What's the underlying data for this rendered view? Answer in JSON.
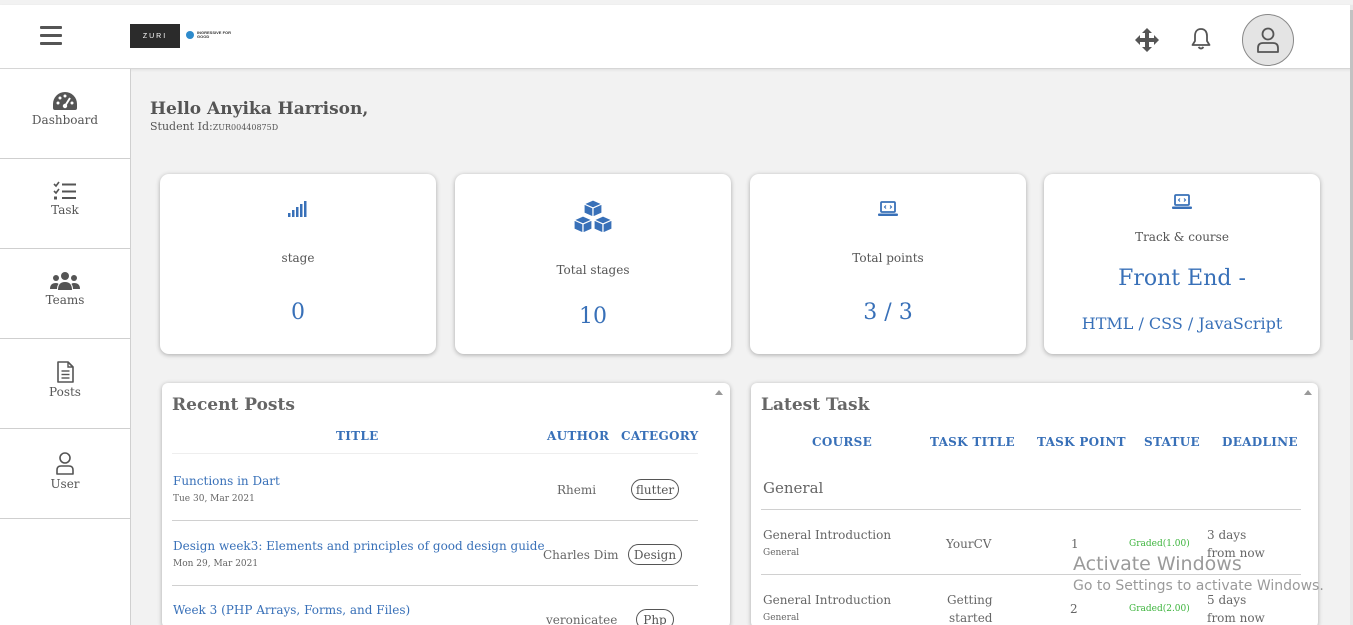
{
  "header": {
    "logo_text": "ZURI",
    "partner_logo_text": "INGRESSIVE FOR GOOD",
    "icons": [
      "menu-icon",
      "move-icon",
      "bell-icon",
      "user-icon"
    ]
  },
  "sidebar": {
    "items": [
      {
        "label": "Dashboard",
        "icon": "dashboard-icon"
      },
      {
        "label": "Task",
        "icon": "task-list-icon"
      },
      {
        "label": "Teams",
        "icon": "teams-icon"
      },
      {
        "label": "Posts",
        "icon": "posts-icon"
      },
      {
        "label": "User",
        "icon": "user-icon"
      }
    ]
  },
  "greeting": {
    "hello": "Hello Anyika Harrison,",
    "student_id_label": "Student Id:",
    "student_id": "ZUR00440875D"
  },
  "cards": [
    {
      "label": "stage",
      "value": "0",
      "icon": "signal-bars-icon"
    },
    {
      "label": "Total stages",
      "value": "10",
      "icon": "cubes-icon"
    },
    {
      "label": "Total points",
      "value": "3 / 3",
      "icon": "laptop-code-icon"
    },
    {
      "label": "Track & course",
      "value": "Front End -",
      "sub": "HTML / CSS / JavaScript",
      "icon": "laptop-code-icon"
    }
  ],
  "recent_posts": {
    "title": "Recent Posts",
    "columns": [
      "TITLE",
      "AUTHOR",
      "CATEGORY"
    ],
    "rows": [
      {
        "title": "Functions in Dart",
        "date": "Tue 30, Mar 2021",
        "author": "Rhemi",
        "category": "flutter"
      },
      {
        "title": "Design week3: Elements and principles of good design guide",
        "date": "Mon 29, Mar 2021",
        "author": "Charles Dim",
        "category": "Design"
      },
      {
        "title": "Week 3 (PHP Arrays, Forms, and Files)",
        "date": "",
        "author": "veronicatee",
        "category": "Php"
      }
    ]
  },
  "latest_task": {
    "title": "Latest Task",
    "columns": [
      "COURSE",
      "TASK TITLE",
      "TASK POINT",
      "STATUE",
      "DEADLINE"
    ],
    "group": "General",
    "rows": [
      {
        "course": "General Introduction",
        "course_sub": "General",
        "task_title": "YourCV",
        "task_point": "1",
        "status": "Graded(1.00)",
        "deadline_1": "3 days",
        "deadline_2": "from now"
      },
      {
        "course": "General Introduction",
        "course_sub": "General",
        "task_title_1": "Getting",
        "task_title_2": "started",
        "task_point": "2",
        "status": "Graded(2.00)",
        "deadline_1": "5 days",
        "deadline_2": "from now"
      }
    ]
  },
  "watermark": {
    "line1": "Activate Windows",
    "line2": "Go to Settings to activate Windows."
  },
  "colors": {
    "accent": "#3870b8",
    "graded": "#3db43d"
  }
}
